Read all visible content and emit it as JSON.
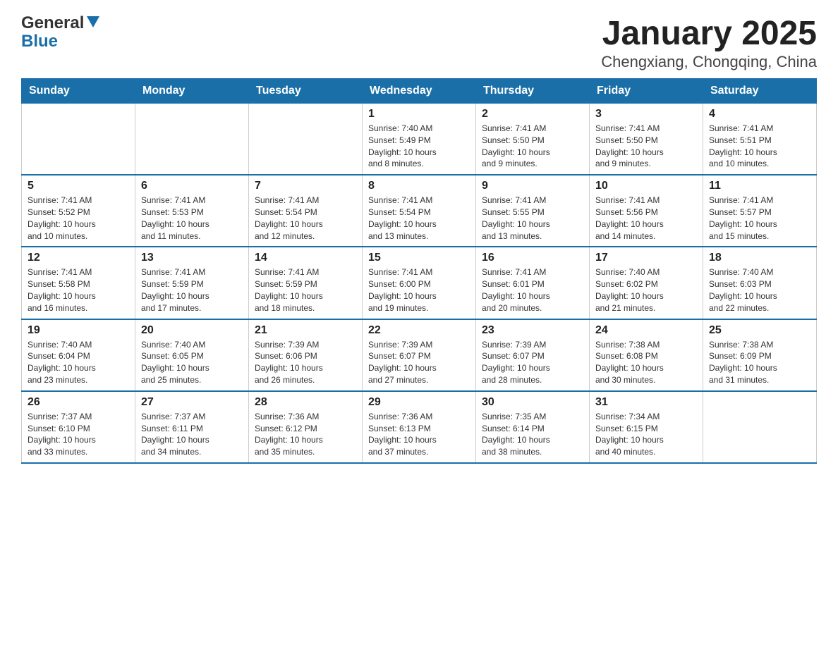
{
  "logo": {
    "line1": "General",
    "line2": "Blue"
  },
  "title": "January 2025",
  "subtitle": "Chengxiang, Chongqing, China",
  "weekdays": [
    "Sunday",
    "Monday",
    "Tuesday",
    "Wednesday",
    "Thursday",
    "Friday",
    "Saturday"
  ],
  "weeks": [
    [
      {
        "day": "",
        "info": ""
      },
      {
        "day": "",
        "info": ""
      },
      {
        "day": "",
        "info": ""
      },
      {
        "day": "1",
        "info": "Sunrise: 7:40 AM\nSunset: 5:49 PM\nDaylight: 10 hours\nand 8 minutes."
      },
      {
        "day": "2",
        "info": "Sunrise: 7:41 AM\nSunset: 5:50 PM\nDaylight: 10 hours\nand 9 minutes."
      },
      {
        "day": "3",
        "info": "Sunrise: 7:41 AM\nSunset: 5:50 PM\nDaylight: 10 hours\nand 9 minutes."
      },
      {
        "day": "4",
        "info": "Sunrise: 7:41 AM\nSunset: 5:51 PM\nDaylight: 10 hours\nand 10 minutes."
      }
    ],
    [
      {
        "day": "5",
        "info": "Sunrise: 7:41 AM\nSunset: 5:52 PM\nDaylight: 10 hours\nand 10 minutes."
      },
      {
        "day": "6",
        "info": "Sunrise: 7:41 AM\nSunset: 5:53 PM\nDaylight: 10 hours\nand 11 minutes."
      },
      {
        "day": "7",
        "info": "Sunrise: 7:41 AM\nSunset: 5:54 PM\nDaylight: 10 hours\nand 12 minutes."
      },
      {
        "day": "8",
        "info": "Sunrise: 7:41 AM\nSunset: 5:54 PM\nDaylight: 10 hours\nand 13 minutes."
      },
      {
        "day": "9",
        "info": "Sunrise: 7:41 AM\nSunset: 5:55 PM\nDaylight: 10 hours\nand 13 minutes."
      },
      {
        "day": "10",
        "info": "Sunrise: 7:41 AM\nSunset: 5:56 PM\nDaylight: 10 hours\nand 14 minutes."
      },
      {
        "day": "11",
        "info": "Sunrise: 7:41 AM\nSunset: 5:57 PM\nDaylight: 10 hours\nand 15 minutes."
      }
    ],
    [
      {
        "day": "12",
        "info": "Sunrise: 7:41 AM\nSunset: 5:58 PM\nDaylight: 10 hours\nand 16 minutes."
      },
      {
        "day": "13",
        "info": "Sunrise: 7:41 AM\nSunset: 5:59 PM\nDaylight: 10 hours\nand 17 minutes."
      },
      {
        "day": "14",
        "info": "Sunrise: 7:41 AM\nSunset: 5:59 PM\nDaylight: 10 hours\nand 18 minutes."
      },
      {
        "day": "15",
        "info": "Sunrise: 7:41 AM\nSunset: 6:00 PM\nDaylight: 10 hours\nand 19 minutes."
      },
      {
        "day": "16",
        "info": "Sunrise: 7:41 AM\nSunset: 6:01 PM\nDaylight: 10 hours\nand 20 minutes."
      },
      {
        "day": "17",
        "info": "Sunrise: 7:40 AM\nSunset: 6:02 PM\nDaylight: 10 hours\nand 21 minutes."
      },
      {
        "day": "18",
        "info": "Sunrise: 7:40 AM\nSunset: 6:03 PM\nDaylight: 10 hours\nand 22 minutes."
      }
    ],
    [
      {
        "day": "19",
        "info": "Sunrise: 7:40 AM\nSunset: 6:04 PM\nDaylight: 10 hours\nand 23 minutes."
      },
      {
        "day": "20",
        "info": "Sunrise: 7:40 AM\nSunset: 6:05 PM\nDaylight: 10 hours\nand 25 minutes."
      },
      {
        "day": "21",
        "info": "Sunrise: 7:39 AM\nSunset: 6:06 PM\nDaylight: 10 hours\nand 26 minutes."
      },
      {
        "day": "22",
        "info": "Sunrise: 7:39 AM\nSunset: 6:07 PM\nDaylight: 10 hours\nand 27 minutes."
      },
      {
        "day": "23",
        "info": "Sunrise: 7:39 AM\nSunset: 6:07 PM\nDaylight: 10 hours\nand 28 minutes."
      },
      {
        "day": "24",
        "info": "Sunrise: 7:38 AM\nSunset: 6:08 PM\nDaylight: 10 hours\nand 30 minutes."
      },
      {
        "day": "25",
        "info": "Sunrise: 7:38 AM\nSunset: 6:09 PM\nDaylight: 10 hours\nand 31 minutes."
      }
    ],
    [
      {
        "day": "26",
        "info": "Sunrise: 7:37 AM\nSunset: 6:10 PM\nDaylight: 10 hours\nand 33 minutes."
      },
      {
        "day": "27",
        "info": "Sunrise: 7:37 AM\nSunset: 6:11 PM\nDaylight: 10 hours\nand 34 minutes."
      },
      {
        "day": "28",
        "info": "Sunrise: 7:36 AM\nSunset: 6:12 PM\nDaylight: 10 hours\nand 35 minutes."
      },
      {
        "day": "29",
        "info": "Sunrise: 7:36 AM\nSunset: 6:13 PM\nDaylight: 10 hours\nand 37 minutes."
      },
      {
        "day": "30",
        "info": "Sunrise: 7:35 AM\nSunset: 6:14 PM\nDaylight: 10 hours\nand 38 minutes."
      },
      {
        "day": "31",
        "info": "Sunrise: 7:34 AM\nSunset: 6:15 PM\nDaylight: 10 hours\nand 40 minutes."
      },
      {
        "day": "",
        "info": ""
      }
    ]
  ]
}
